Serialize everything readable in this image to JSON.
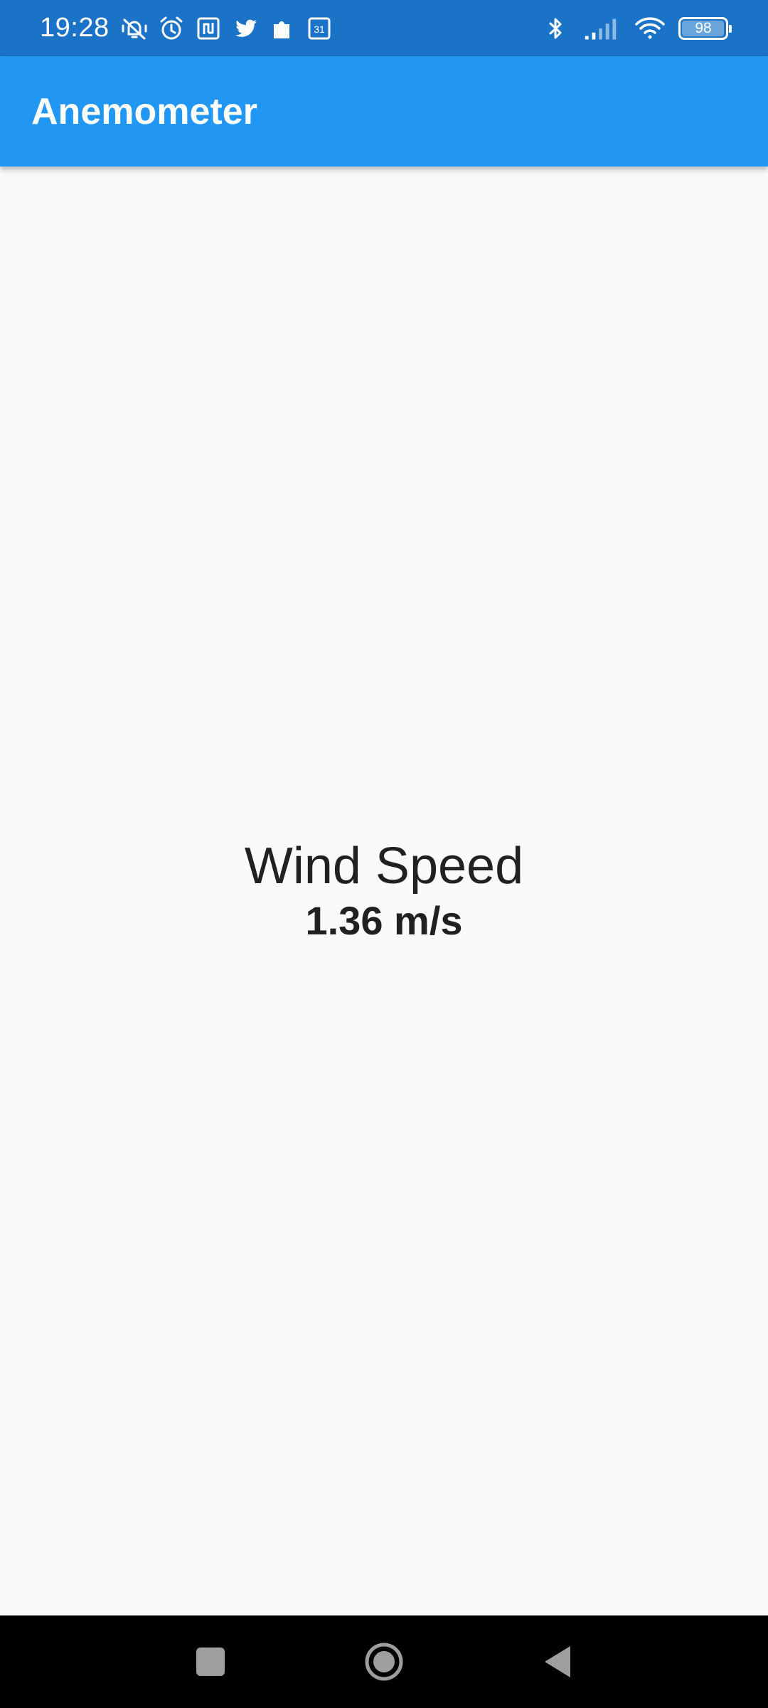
{
  "status_bar": {
    "time": "19:28",
    "calendar_date": "31",
    "battery_level": "98",
    "battery_percent": 98,
    "background_color": "#1a73c7",
    "left_icons": [
      "vibrate-icon",
      "alarm-icon",
      "nfc-icon",
      "twitter-icon",
      "puzzle-icon",
      "calendar-icon"
    ],
    "right_icons": [
      "bluetooth-icon",
      "signal-icon",
      "wifi-icon",
      "battery-icon"
    ]
  },
  "app_bar": {
    "title": "Anemometer",
    "background_color": "#2196f3"
  },
  "main": {
    "label": "Wind Speed",
    "value": "1.36 m/s",
    "background_color": "#fafafa"
  },
  "nav_bar": {
    "buttons": [
      "recents-icon",
      "home-icon",
      "back-icon"
    ],
    "background_color": "#000000"
  }
}
